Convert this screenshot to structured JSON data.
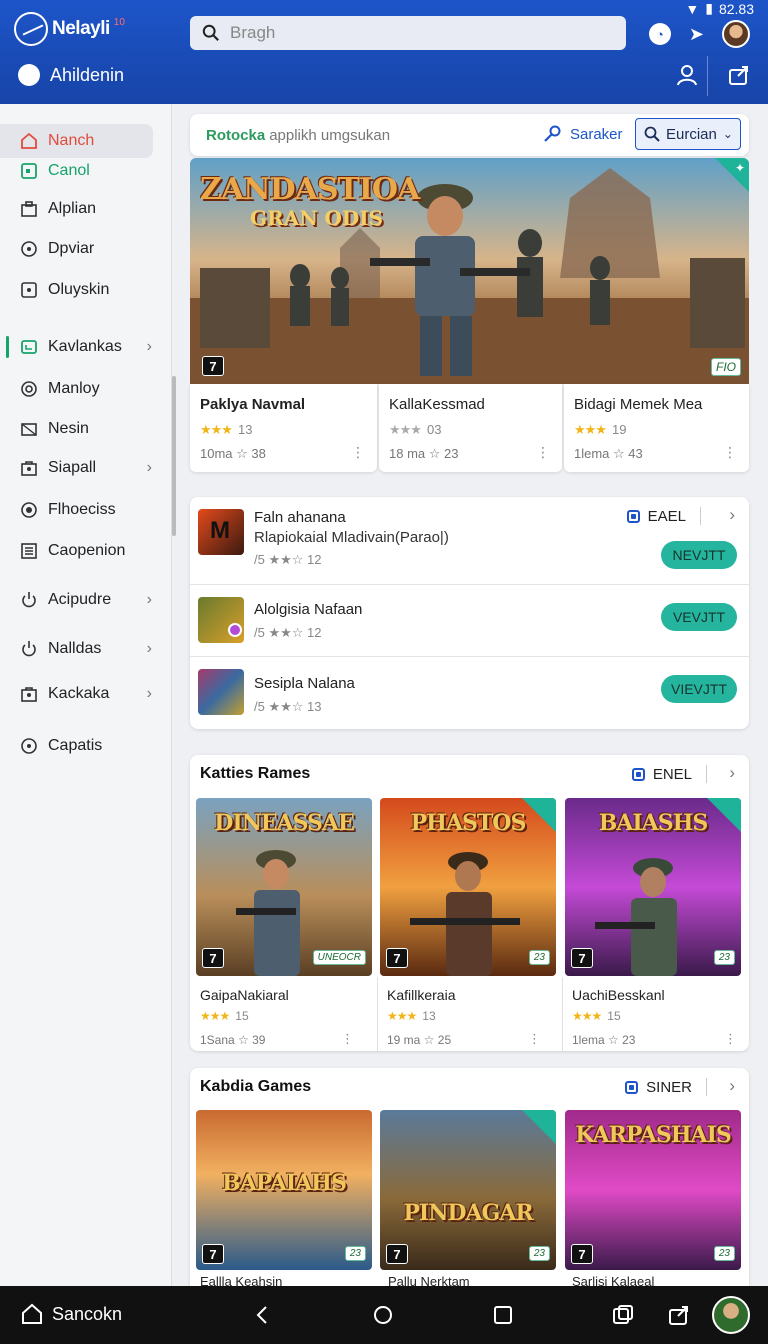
{
  "status": {
    "time": "82.83"
  },
  "header": {
    "brand": "Nelayli",
    "brand_badge": "10",
    "search_placeholder": "Bragh",
    "user_name": "Ahildenin"
  },
  "sidebar": {
    "items": [
      {
        "label": "Nanch",
        "icon": "home-icon"
      },
      {
        "label": "Canol",
        "icon": "square-icon"
      },
      {
        "label": "Alplian",
        "icon": "box-icon"
      },
      {
        "label": "Dpviar",
        "icon": "circle-icon"
      },
      {
        "label": "Oluyskin",
        "icon": "square-dot-icon"
      },
      {
        "label": "Kavlankas",
        "icon": "tv-icon"
      },
      {
        "label": "Manloy",
        "icon": "at-icon"
      },
      {
        "label": "Nesin",
        "icon": "mail-icon"
      },
      {
        "label": "Siapall",
        "icon": "bag-icon"
      },
      {
        "label": "Flhoeciss",
        "icon": "gear-icon"
      },
      {
        "label": "Caopenion",
        "icon": "list-icon"
      },
      {
        "label": "Acipudre",
        "icon": "power-icon"
      },
      {
        "label": "Nalldas",
        "icon": "power-icon"
      },
      {
        "label": "Kackaka",
        "icon": "bag-icon"
      },
      {
        "label": "Capatis",
        "icon": "circle-icon"
      }
    ]
  },
  "filter": {
    "title": "Rotocka",
    "subtitle": "applikh umgsukan",
    "search_label": "Saraker",
    "dropdown_value": "Eurcian"
  },
  "hero": {
    "title": "ZANDASTIOA",
    "subtitle": "GRAN ODIS",
    "badge": "7",
    "rating_chip": "FIO"
  },
  "featured": [
    {
      "name": "Paklya Navmal",
      "stars": "★★★",
      "count": "13",
      "meta": "10ma ☆ 38"
    },
    {
      "name": "KallaKessmad",
      "stars": "★★★",
      "count": "03",
      "meta": "18 ma ☆ 23"
    },
    {
      "name": "Bidagi Memek Mea",
      "stars": "★★★",
      "count": "19",
      "meta": "1lema ☆ 43"
    }
  ],
  "list": {
    "tag": "EAEL",
    "rows": [
      {
        "title": "Faln ahanana",
        "subtitle": "Rlapiokaial Mladivain(Parao|)",
        "meta": "/5 ★★☆ 12",
        "button": "NEVJTT"
      },
      {
        "title": "Alolgisia Nafaan",
        "subtitle": "",
        "meta": "/5 ★★☆ 12",
        "button": "VEVJTT"
      },
      {
        "title": "Sesipla Nalana",
        "subtitle": "",
        "meta": "/5 ★★☆ 13",
        "button": "VIEVJTT"
      }
    ]
  },
  "section1": {
    "title": "Katties Rames",
    "tag": "ENEL",
    "tiles": [
      {
        "art": "DINEASSAE",
        "name": "GaipaNakiaral",
        "stars": "★★★",
        "count": "15",
        "meta": "1Sana ☆ 39",
        "chip": "UNEOCR"
      },
      {
        "art": "PHASTOS",
        "name": "Kafillkeraia",
        "stars": "★★★",
        "count": "13",
        "meta": "19 ma ☆ 25",
        "chip": "23"
      },
      {
        "art": "BAIASHS",
        "name": "UachiBesskanl",
        "stars": "★★★",
        "count": "15",
        "meta": "1lema ☆ 23",
        "chip": "23"
      }
    ]
  },
  "section2": {
    "title": "Kabdia Games",
    "tag": "SINER",
    "tiles": [
      {
        "art": "BAPAIAHS",
        "name": "Eallla Keahsin"
      },
      {
        "art": "PINDAGAR",
        "name": "Pallu Nerktam"
      },
      {
        "art": "KARPASHAIS",
        "name": "Sarlisi Kalaeal"
      }
    ]
  },
  "bottom_nav": {
    "home_label": "Sancokn"
  },
  "colors": {
    "header": "#1d55c9",
    "accent_green": "#25b59f",
    "active_red": "#e24b3b",
    "star": "#f1b519"
  }
}
